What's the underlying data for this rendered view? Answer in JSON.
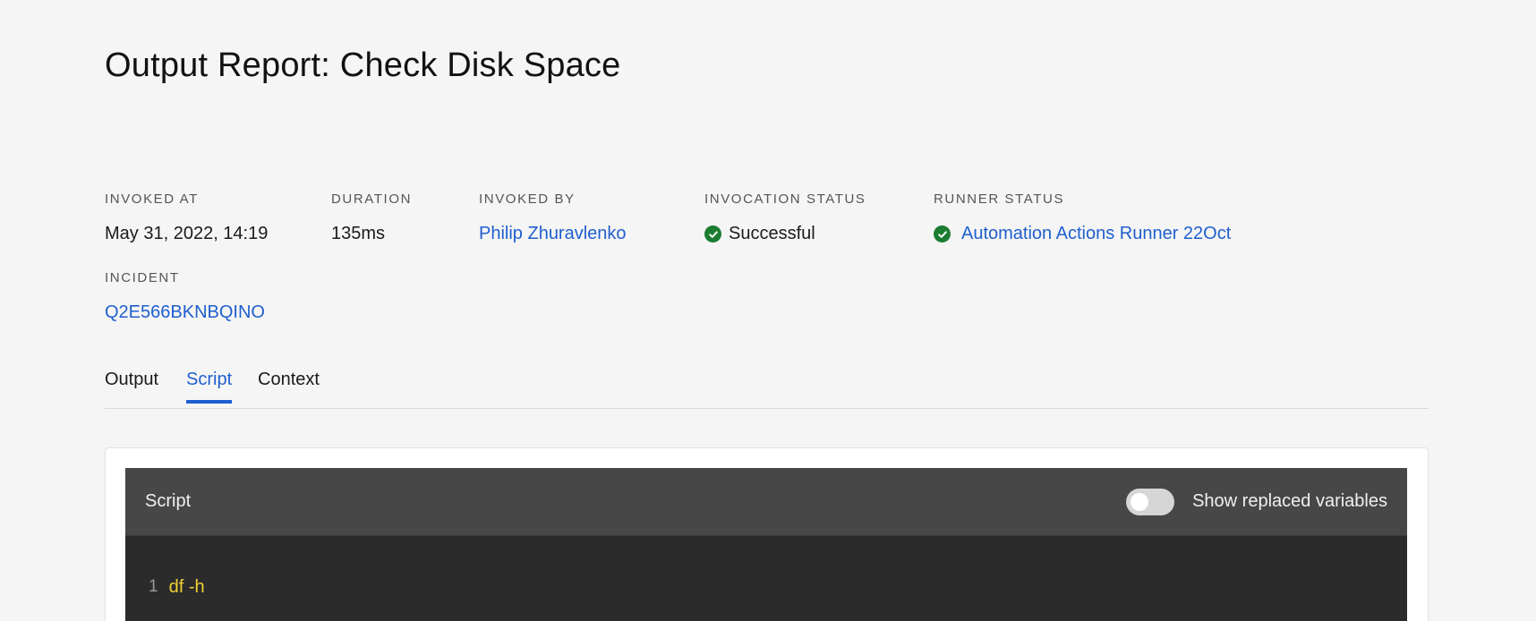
{
  "page": {
    "title": "Output Report: Check Disk Space"
  },
  "meta": {
    "invoked_at": {
      "label": "INVOKED AT",
      "value": "May 31, 2022, 14:19"
    },
    "duration": {
      "label": "DURATION",
      "value": "135ms"
    },
    "invoked_by": {
      "label": "INVOKED BY",
      "value": "Philip Zhuravlenko"
    },
    "invocation_status": {
      "label": "INVOCATION STATUS",
      "value": "Successful",
      "icon": "check-circle-icon"
    },
    "runner_status": {
      "label": "RUNNER STATUS",
      "value": "Automation Actions Runner 22Oct",
      "icon": "check-circle-icon"
    },
    "incident": {
      "label": "INCIDENT",
      "value": "Q2E566BKNBQINO"
    }
  },
  "tabs": [
    {
      "label": "Output",
      "active": false
    },
    {
      "label": "Script",
      "active": true
    },
    {
      "label": "Context",
      "active": false
    }
  ],
  "script_panel": {
    "title": "Script",
    "toggle_label": "Show replaced variables",
    "toggle_on": false,
    "lines": [
      {
        "number": "1",
        "text": "df -h"
      }
    ]
  },
  "colors": {
    "accent": "#1f5fcf",
    "success": "#1b7d32",
    "code_text": "#f2d034",
    "editor_bg": "#2b2b2b",
    "editor_header_bg": "#474747"
  }
}
